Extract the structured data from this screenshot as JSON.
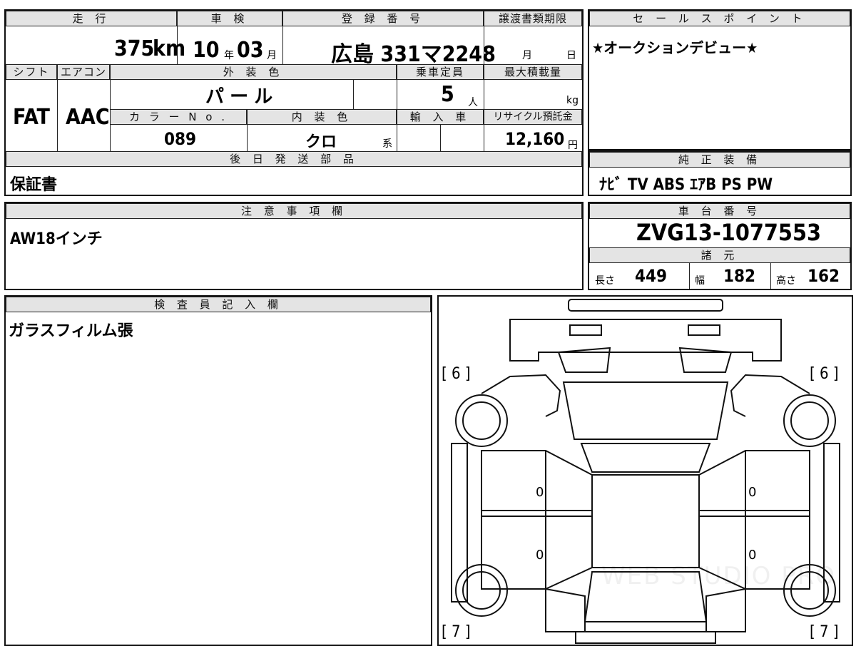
{
  "summary": {
    "h_mileage": "走 行",
    "mileage_value": "375",
    "mileage_unit": "km",
    "h_inspection": "車 検",
    "insp_year": "10",
    "insp_year_unit": "年",
    "insp_month": "03",
    "insp_month_unit": "月",
    "h_registration": "登 録 番 号",
    "registration_value": "広島 331マ2248",
    "h_transfer": "譲渡書類期限",
    "transfer_month_unit": "月",
    "transfer_day_unit": "日",
    "h_shift": "シフト",
    "h_aircon": "エアコン",
    "h_exterior": "外 装 色",
    "h_capacity": "乗車定員",
    "h_maxload": "最大積載量",
    "shift_value": "FAT",
    "aircon_value": "AAC",
    "exterior_value": "パ ー ル",
    "capacity_value": "5",
    "capacity_unit": "人",
    "maxload_unit": "kg",
    "h_color_no": "カ ラ ー N o .",
    "h_interior": "内 装 色",
    "h_import": "輸 入 車",
    "h_recycle": "リサイクル預託金",
    "color_no_value": "089",
    "interior_value": "クロ",
    "interior_suffix": "系",
    "recycle_value": "12,160",
    "recycle_unit": "円",
    "h_later_parts": "後 日 発 送 部 品",
    "later_parts_value": "保証書"
  },
  "sales_point": {
    "header": "セ ー ル ス ポ イ ン ト",
    "text": "★オークションデビュー★"
  },
  "equipment": {
    "header": "純 正 装 備",
    "text": "ﾅﾋﾞ  TV  ABS  ｴｱB  PS  PW"
  },
  "notes": {
    "header": "注 意 事 項 欄",
    "text": "AW18インチ"
  },
  "chassis": {
    "header": "車 台 番 号",
    "value": "ZVG13-1077553"
  },
  "specs": {
    "header": "諸 元",
    "length_label": "長さ",
    "length_value": "449",
    "width_label": "幅",
    "width_value": "182",
    "height_label": "高さ",
    "height_value": "162"
  },
  "inspector": {
    "header": "検 査 員 記 入 欄",
    "text": "ガラスフィルム張"
  },
  "diagram": {
    "front_left": "[ 6 ]",
    "front_right": "[ 6 ]",
    "rear_left": "[ 7 ]",
    "rear_right": "[ 7 ]",
    "door_marks": [
      "0",
      "0",
      "0",
      "0"
    ],
    "watermark": "WEB STUDIO PRO"
  }
}
